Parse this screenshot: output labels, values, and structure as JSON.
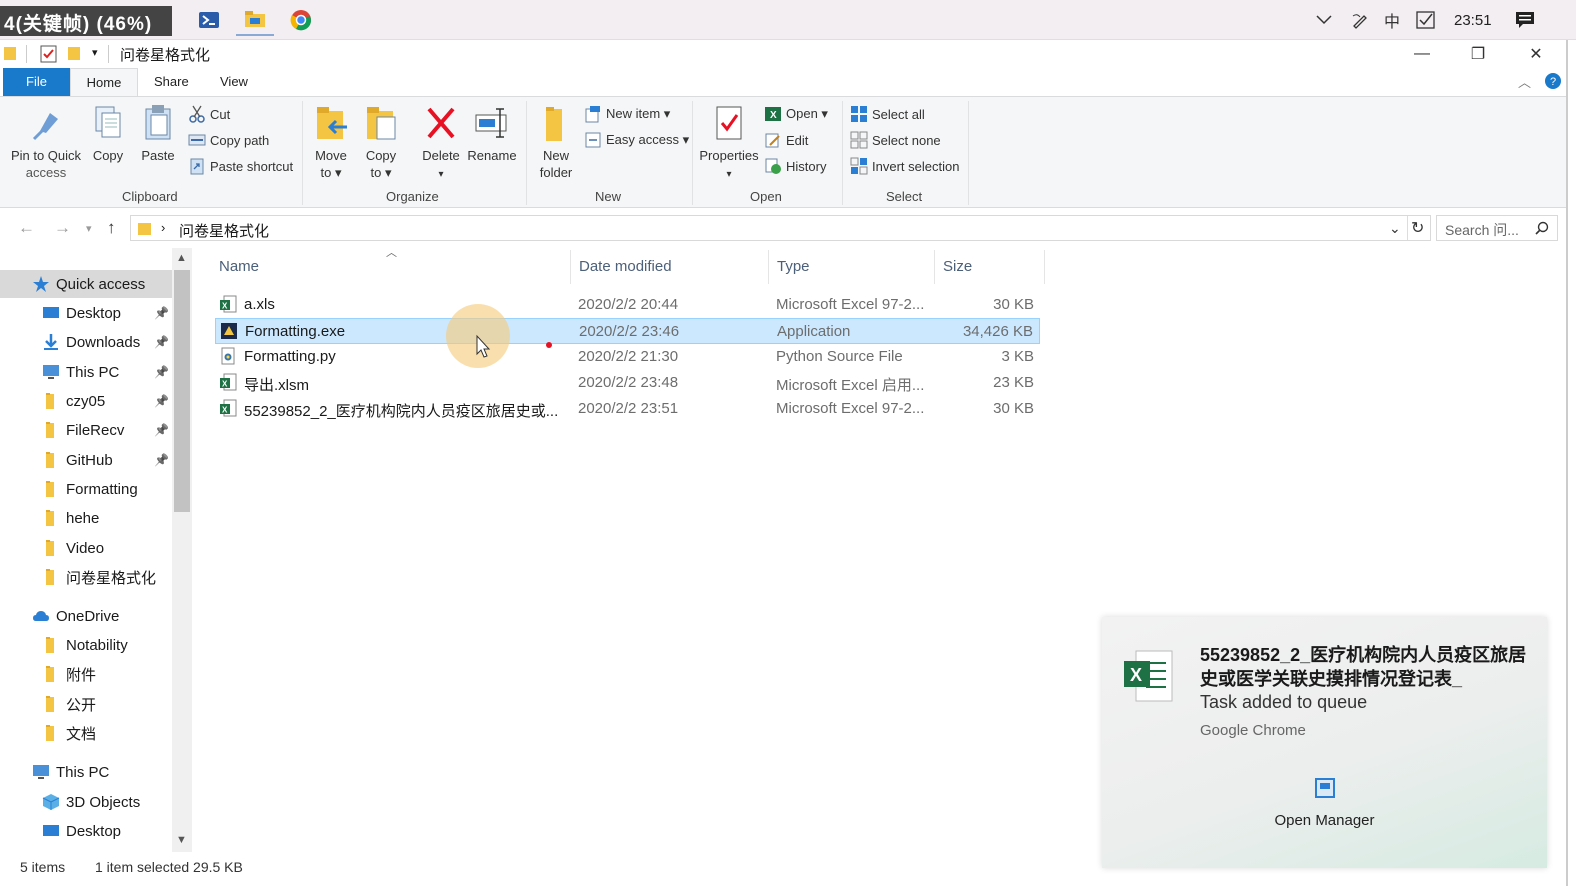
{
  "taskbar": {
    "overlay_label": "4(关键帧) (46%)",
    "clock": "23:51",
    "apps": [
      "powershell-icon",
      "file-explorer-icon",
      "chrome-icon"
    ],
    "tray": [
      "chevron-down-icon",
      "pen-icon",
      "ime-icon",
      "checkbox-icon",
      "notification-icon"
    ],
    "ime_label": "中"
  },
  "window": {
    "title": "问卷星格式化",
    "controls": {
      "minimize": "—",
      "maximize": "❐",
      "close": "✕"
    }
  },
  "ribbon_tabs": {
    "file": "File",
    "home": "Home",
    "share": "Share",
    "view": "View"
  },
  "ribbon": {
    "clipboard": {
      "label": "Clipboard",
      "pin": "Pin to Quick\naccess",
      "pin_l1": "Pin to Quick",
      "pin_l2": "access",
      "copy": "Copy",
      "paste": "Paste",
      "cut": "Cut",
      "copy_path": "Copy path",
      "paste_shortcut": "Paste shortcut"
    },
    "organize": {
      "label": "Organize",
      "move_l1": "Move",
      "move_l2": "to ▾",
      "copy_l1": "Copy",
      "copy_l2": "to ▾",
      "delete": "Delete",
      "delete_arrow": "▾",
      "rename": "Rename"
    },
    "new": {
      "label": "New",
      "new_folder_l1": "New",
      "new_folder_l2": "folder",
      "new_item": "New item ▾",
      "easy_access": "Easy access ▾"
    },
    "open": {
      "label": "Open",
      "properties": "Properties",
      "properties_arrow": "▾",
      "open": "Open ▾",
      "edit": "Edit",
      "history": "History"
    },
    "select": {
      "label": "Select",
      "select_all": "Select all",
      "select_none": "Select none",
      "invert": "Invert selection"
    }
  },
  "address": {
    "path": "问卷星格式化",
    "search_placeholder": "Search 问..."
  },
  "sidebar": {
    "items": [
      {
        "label": "Quick access",
        "icon": "star-icon",
        "pinned": false,
        "selected": true,
        "indent": 1
      },
      {
        "label": "Desktop",
        "icon": "desktop-icon",
        "pinned": true,
        "indent": 2
      },
      {
        "label": "Downloads",
        "icon": "download-icon",
        "pinned": true,
        "indent": 2
      },
      {
        "label": "This PC",
        "icon": "pc-icon",
        "pinned": true,
        "indent": 2
      },
      {
        "label": "czy05",
        "icon": "folder-icon",
        "pinned": true,
        "indent": 2
      },
      {
        "label": "FileRecv",
        "icon": "folder-icon",
        "pinned": true,
        "indent": 2
      },
      {
        "label": "GitHub",
        "icon": "folder-icon",
        "pinned": true,
        "indent": 2
      },
      {
        "label": "Formatting",
        "icon": "folder-icon",
        "pinned": false,
        "indent": 2
      },
      {
        "label": "hehe",
        "icon": "folder-icon",
        "pinned": false,
        "indent": 2
      },
      {
        "label": "Video",
        "icon": "folder-icon",
        "pinned": false,
        "indent": 2
      },
      {
        "label": "问卷星格式化",
        "icon": "folder-icon",
        "pinned": false,
        "indent": 2
      },
      {
        "label": "OneDrive",
        "icon": "cloud-icon",
        "pinned": false,
        "indent": 1
      },
      {
        "label": "Notability",
        "icon": "folder-icon",
        "pinned": false,
        "indent": 2
      },
      {
        "label": "附件",
        "icon": "folder-icon",
        "pinned": false,
        "indent": 2
      },
      {
        "label": "公开",
        "icon": "folder-icon",
        "pinned": false,
        "indent": 2
      },
      {
        "label": "文档",
        "icon": "folder-icon",
        "pinned": false,
        "indent": 2
      },
      {
        "label": "This PC",
        "icon": "pc-icon",
        "pinned": false,
        "indent": 1
      },
      {
        "label": "3D Objects",
        "icon": "cube-icon",
        "pinned": false,
        "indent": 2
      },
      {
        "label": "Desktop",
        "icon": "desktop-icon",
        "pinned": false,
        "indent": 2
      }
    ]
  },
  "files": {
    "columns": {
      "name": "Name",
      "date": "Date modified",
      "type": "Type",
      "size": "Size"
    },
    "rows": [
      {
        "name": "a.xls",
        "date": "2020/2/2 20:44",
        "type": "Microsoft Excel 97-2...",
        "size": "30 KB",
        "icon": "excel-icon",
        "selected": false
      },
      {
        "name": "Formatting.exe",
        "date": "2020/2/2 23:46",
        "type": "Application",
        "size": "34,426 KB",
        "icon": "exe-icon",
        "selected": true
      },
      {
        "name": "Formatting.py",
        "date": "2020/2/2 21:30",
        "type": "Python Source File",
        "size": "3 KB",
        "icon": "python-icon",
        "selected": false
      },
      {
        "name": "导出.xlsm",
        "date": "2020/2/2 23:48",
        "type": "Microsoft Excel 启用...",
        "size": "23 KB",
        "icon": "excel-icon",
        "selected": false
      },
      {
        "name": "55239852_2_医疗机构院内人员疫区旅居史或...",
        "date": "2020/2/2 23:51",
        "type": "Microsoft Excel 97-2...",
        "size": "30 KB",
        "icon": "excel-icon",
        "selected": false
      }
    ]
  },
  "status": {
    "items": "5 items",
    "selected": "1 item selected  29.5 KB"
  },
  "toast": {
    "title": "55239852_2_医疗机构院内人员疫区旅居史或医学关联史摸排情况登记表_",
    "message": "Task added to queue",
    "source": "Google Chrome",
    "action": "Open Manager"
  },
  "colors": {
    "accent": "#1979ca",
    "selection": "#cce8ff",
    "folder": "#f4c542",
    "excel": "#1e7145"
  }
}
